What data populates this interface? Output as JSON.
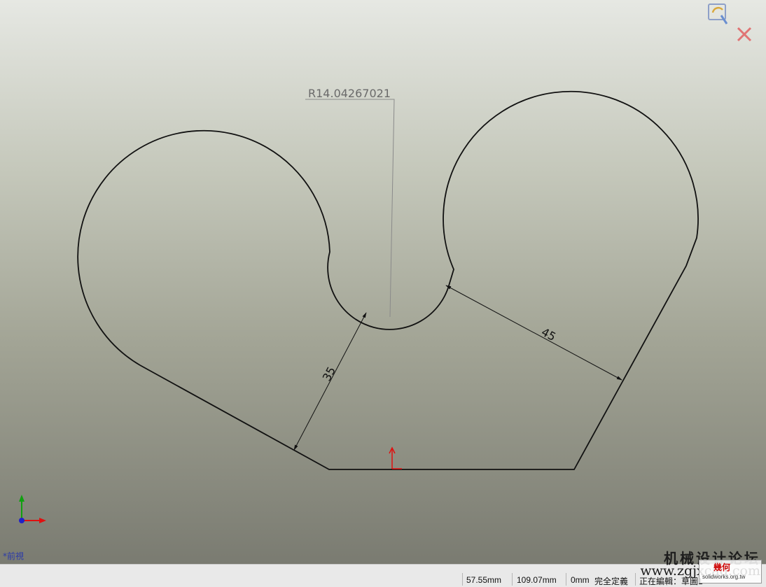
{
  "drawing": {
    "dimension_radius": "R14.04267021",
    "dimension_35": "35",
    "dimension_45": "45"
  },
  "view": {
    "name": "*前視"
  },
  "status_bar": {
    "x_coord": "57.55mm",
    "y_coord": "109.07mm",
    "z_coord": "0mm",
    "definition_state": "完全定義",
    "edit_state": "正在編輯：草圖1"
  },
  "watermark": {
    "title": "机械设计论坛",
    "url": "www.zgjxcad.com",
    "logo_text": "幾何",
    "logo_sub": "solidworks.org.tw"
  },
  "icons": {
    "rebuild": "rebuild-icon",
    "exit_sketch": "close-icon",
    "origin": "origin-icon",
    "triad": "triad-icon"
  },
  "colors": {
    "sketch_line": "#111111",
    "dimension_line": "#555555",
    "origin_red": "#e01010",
    "triad_green": "#10a010",
    "triad_blue": "#2020c8"
  }
}
